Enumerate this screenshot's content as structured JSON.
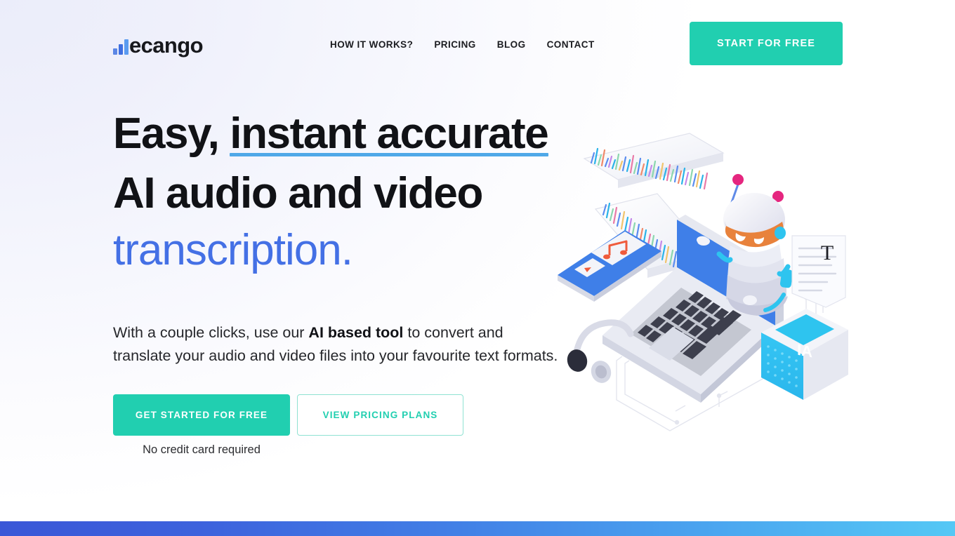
{
  "brand": {
    "name": "ecango",
    "logo_bar_colors": [
      "#5b86e5",
      "#3f6fe0",
      "#5b9bf0"
    ]
  },
  "nav": {
    "items": [
      {
        "label": "HOW IT WORKS?"
      },
      {
        "label": "PRICING"
      },
      {
        "label": "BLOG"
      },
      {
        "label": "CONTACT"
      }
    ],
    "cta_label": "START FOR FREE"
  },
  "hero": {
    "headline_line1_plain": "Easy, ",
    "headline_line1_underlined": "instant accurate",
    "headline_line2": "AI audio and video",
    "headline_line3_accent": "transcription.",
    "subtitle_part1": "With a couple clicks, use our ",
    "subtitle_bold": "AI based tool",
    "subtitle_part2": " to convert and translate your audio and video files into your favourite text formats.",
    "primary_cta": "GET STARTED FOR FREE",
    "secondary_cta": "VIEW PRICING PLANS",
    "note": "No credit card required"
  },
  "illustration": {
    "document_glyph": "T",
    "cube_label": "IA"
  },
  "colors": {
    "accent_teal": "#21cfb0",
    "accent_blue": "#4470e5",
    "underline_blue": "#4fa8e8",
    "text_dark": "#111216",
    "bar_gradient_start": "#3a57d7",
    "bar_gradient_end": "#55c8f5",
    "page_bg_start": "#ebedfa",
    "page_bg_end": "#ffffff"
  }
}
